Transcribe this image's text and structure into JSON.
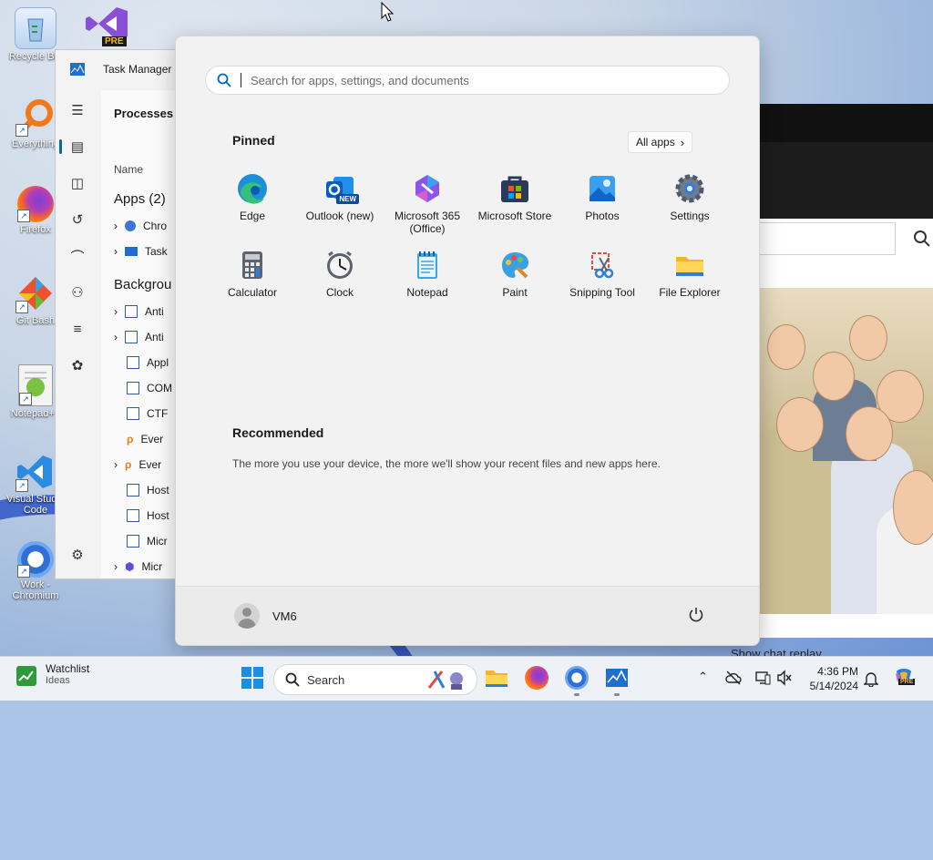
{
  "desktop": {
    "icons": [
      {
        "label": "Recycle Bin",
        "icon": "recycle-bin-icon"
      },
      {
        "label": "Everything",
        "icon": "everything-icon"
      },
      {
        "label": "Firefox",
        "icon": "firefox-icon"
      },
      {
        "label": "Git Bash",
        "icon": "git-bash-icon"
      },
      {
        "label": "Notepad++",
        "icon": "notepad-plus-plus-icon"
      },
      {
        "label": "Visual Studio Code",
        "icon": "vscode-icon"
      },
      {
        "label": "Work - Chromium",
        "icon": "chromium-icon"
      }
    ],
    "vs_badge": "PRE"
  },
  "task_manager": {
    "title": "Task Manager",
    "section": "Processes",
    "column_name": "Name",
    "apps_header": "Apps (2)",
    "apps": [
      "Chro",
      "Task"
    ],
    "background_header": "Backgrou",
    "background": [
      "Anti",
      "Anti",
      "Appl",
      "COM",
      "CTF",
      "Ever",
      "Ever",
      "Host",
      "Host",
      "Micr",
      "Micr"
    ]
  },
  "background_window": {
    "caption": "Show chat replay"
  },
  "start_menu": {
    "search_placeholder": "Search for apps, settings, and documents",
    "pinned_title": "Pinned",
    "all_apps": "All apps",
    "pinned": [
      {
        "label": "Edge",
        "icon": "edge-icon"
      },
      {
        "label": "Outlook (new)",
        "icon": "outlook-icon",
        "badge": "NEW"
      },
      {
        "label": "Microsoft 365 (Office)",
        "icon": "m365-icon"
      },
      {
        "label": "Microsoft Store",
        "icon": "store-icon"
      },
      {
        "label": "Photos",
        "icon": "photos-icon"
      },
      {
        "label": "Settings",
        "icon": "settings-gear-icon"
      },
      {
        "label": "Calculator",
        "icon": "calculator-icon"
      },
      {
        "label": "Clock",
        "icon": "clock-icon"
      },
      {
        "label": "Notepad",
        "icon": "notepad-icon"
      },
      {
        "label": "Paint",
        "icon": "paint-icon"
      },
      {
        "label": "Snipping Tool",
        "icon": "snipping-tool-icon"
      },
      {
        "label": "File Explorer",
        "icon": "file-explorer-icon"
      }
    ],
    "recommended_title": "Recommended",
    "recommended_text": "The more you use your device, the more we'll show your recent files and new apps here.",
    "user_name": "VM6"
  },
  "taskbar": {
    "weather_title": "Watchlist",
    "weather_sub": "Ideas",
    "search_label": "Search",
    "time": "4:36 PM",
    "date": "5/14/2024",
    "copilot_badge": "PRE"
  },
  "colors": {
    "accent": "#0067c0",
    "start_bg": "#f2f2f2",
    "taskbar_bg": "#eef1f6"
  }
}
